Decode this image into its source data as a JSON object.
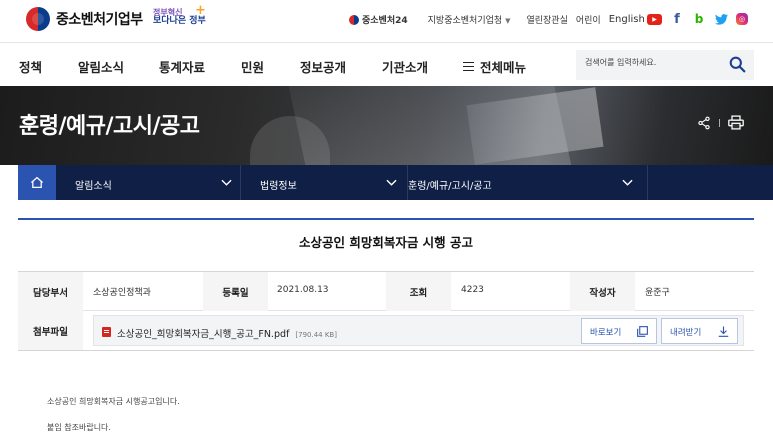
{
  "header": {
    "logo_text": "중소벤처기업부",
    "slogan_line1": "정부혁신",
    "slogan_line2": "보다나은 정부",
    "util_links": {
      "brand24": "중소벤처24",
      "regional": "지방중소벤처기업청",
      "open_office": "열린장관실",
      "kids": "어린이",
      "english": "English"
    },
    "sns": [
      "youtube-icon",
      "facebook-icon",
      "blog-icon",
      "twitter-icon",
      "instagram-icon"
    ]
  },
  "gnb": {
    "items": [
      "정책",
      "알림소식",
      "통계자료",
      "민원",
      "정보공개",
      "기관소개"
    ],
    "all_menu": "전체메뉴",
    "search_placeholder": "검색어를 입력하세요."
  },
  "visual": {
    "title": "훈령/예규/고시/공고"
  },
  "subnav": {
    "level1": "알림소식",
    "level2": "법령정보",
    "level3": "훈령/예규/고시/공고"
  },
  "post": {
    "title": "소상공인 희망회복자금 시행 공고",
    "labels": {
      "dept": "담당부서",
      "date": "등록일",
      "views": "조회",
      "author": "작성자",
      "attachment": "첨부파일"
    },
    "dept": "소상공인정책과",
    "date": "2021.08.13",
    "views": "4223",
    "author": "윤준구",
    "file": {
      "name": "소상공인_희망회복자금_시행_공고_FN.pdf",
      "size": "[790.44 KB]",
      "preview_label": "바로보기",
      "download_label": "내려받기"
    },
    "body": [
      "소상공인 희망회복자금 시행공고입니다.",
      "붙임 참조바랍니다."
    ]
  },
  "colors": {
    "primary": "#2a54b0",
    "subnav_bg": "#0f1f45"
  }
}
